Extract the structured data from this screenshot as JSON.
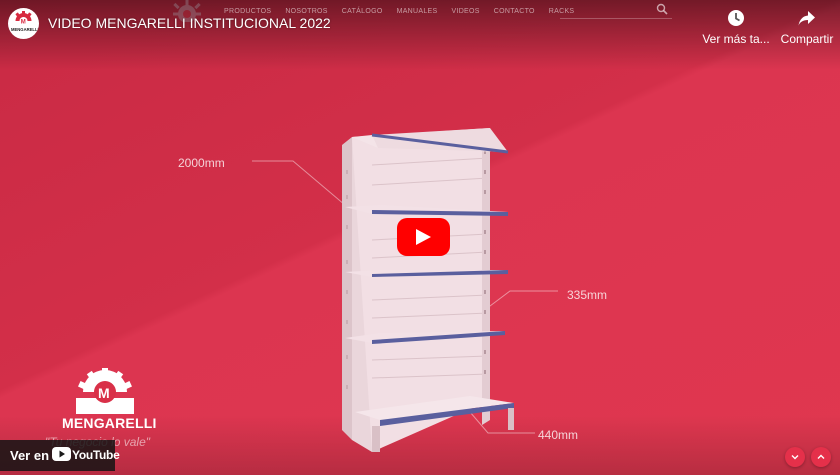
{
  "video": {
    "title": "VIDEO MENGARELLI INSTITUCIONAL 2022",
    "channel_logo_text": "MENGARELLI"
  },
  "actions": {
    "watch_later": {
      "label": "Ver más ta...",
      "icon": "clock-icon"
    },
    "share": {
      "label": "Compartir",
      "icon": "share-arrow-icon"
    }
  },
  "site_nav": [
    "PRODUCTOS",
    "NOSOTROS",
    "CATÁLOGO",
    "MANUALES",
    "VIDEOS",
    "CONTACTO",
    "RACKS"
  ],
  "dimensions": {
    "height": "2000mm",
    "shelf_spacing": "335mm",
    "depth": "440mm"
  },
  "watermark": {
    "brand": "MENGARELLI",
    "slogan": "\"Tu negocio lo vale\""
  },
  "watch_on": {
    "prefix": "Ver en",
    "brand": "YouTube"
  },
  "colors": {
    "background": "#d93048",
    "play_button": "#ff0000",
    "shelf_edge": "#5a5f9e",
    "shelf_body": "#f1dde2"
  }
}
